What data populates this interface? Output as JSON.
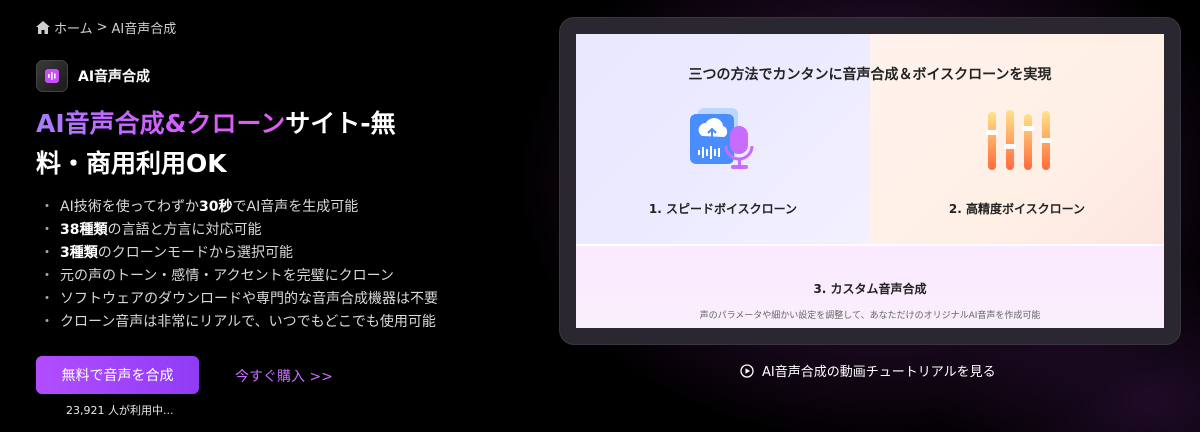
{
  "breadcrumb": {
    "home": "ホーム",
    "separator": ">",
    "current": "AI音声合成"
  },
  "product": {
    "name": "AI音声合成"
  },
  "headline": {
    "highlight": "AI音声合成&クローン",
    "rest_line1": "サイト-無",
    "line2": "料・商用利用OK"
  },
  "features": [
    {
      "pre": "AI技術を使ってわずか",
      "bold": "30秒",
      "post": "でAI音声を生成可能"
    },
    {
      "pre": "",
      "bold": "38種類",
      "post": "の言語と方言に対応可能"
    },
    {
      "pre": "",
      "bold": "3種類",
      "post": "のクローンモードから選択可能"
    },
    {
      "pre": "元の声のトーン・感情・アクセントを完璧にクローン",
      "bold": "",
      "post": ""
    },
    {
      "pre": "ソフトウェアのダウンロードや専門的な音声合成機器は不要",
      "bold": "",
      "post": ""
    },
    {
      "pre": "クローン音声は非常にリアルで、いつでもどこでも使用可能",
      "bold": "",
      "post": ""
    }
  ],
  "feature_bullet": "・",
  "cta": {
    "label": "無料で音声を合成",
    "buy": "今すぐ購入 >>",
    "users": "23,921 人が利用中..."
  },
  "card": {
    "title": "三つの方法でカンタンに音声合成＆ボイスクローンを実現",
    "method1": "1. スピードボイスクローン",
    "method2": "2. 高精度ボイスクローン",
    "method3": "3. カスタム音声合成",
    "method3_desc": "声のパラメータや細かい設定を調整して、あなただけのオリジナルAI音声を作成可能"
  },
  "tutorial": {
    "label": "AI音声合成の動画チュートリアルを見る"
  },
  "colors": {
    "accent": "#b24dff",
    "link": "#c96dff",
    "bg": "#000000"
  }
}
